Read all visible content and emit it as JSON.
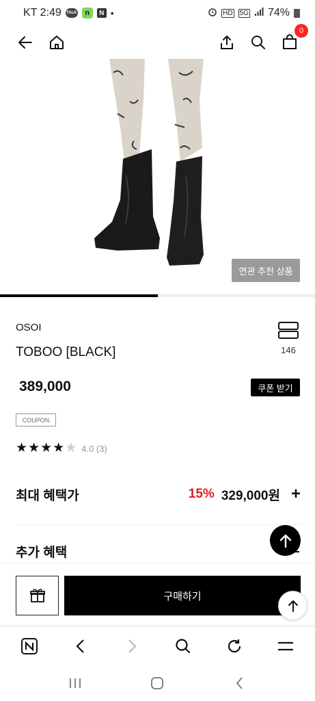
{
  "status_bar": {
    "carrier_time": "KT 2:49",
    "icons_left": [
      "talk-icon",
      "n-green-icon",
      "naver-icon",
      "dot"
    ],
    "talk_label": "TALK",
    "n_green_label": "n",
    "naver_label": "N",
    "dot": "•",
    "hd_label": "HD",
    "net_label": "5G",
    "battery": "74%"
  },
  "header": {
    "back_icon": "arrow-left-icon",
    "home_icon": "home-icon",
    "share_icon": "share-icon",
    "search_icon": "search-icon",
    "cart_icon": "shopping-bag-icon",
    "cart_count": "0"
  },
  "product_image": {
    "related_label": "연관 추천 상품",
    "progress": 0.5
  },
  "product": {
    "brand": "OSOI",
    "name": "TOBOO [BLACK]",
    "like_count": "146",
    "price": "389,000",
    "coupon_button": "쿠폰 받기",
    "coupon_tag": "COUPON",
    "rating": 4,
    "rating_max": 5,
    "rating_text": "4.0 (3)"
  },
  "benefit": {
    "title": "최대 혜택가",
    "discount": "15%",
    "price": "329,000원",
    "plus": "+"
  },
  "extra": {
    "title": "추가 혜택"
  },
  "purchase": {
    "buy_label": "구매하기"
  },
  "colors": {
    "accent_red": "#e8191b",
    "badge_red": "#f22222",
    "black": "#000000",
    "related_gray": "#9a9a9a"
  }
}
